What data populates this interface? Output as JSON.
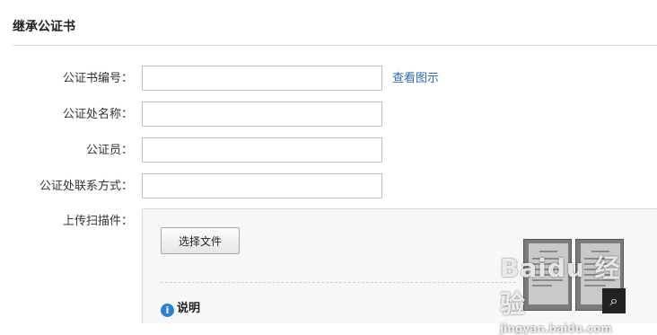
{
  "section": {
    "title": "继承公证书"
  },
  "form": {
    "fields": [
      {
        "label": "公证书编号：",
        "value": "",
        "placeholder": ""
      },
      {
        "label": "公证处名称：",
        "value": "",
        "placeholder": ""
      },
      {
        "label": "公证员：",
        "value": "",
        "placeholder": ""
      },
      {
        "label": "公证处联系方式：",
        "value": "",
        "placeholder": ""
      }
    ],
    "view_sample_link": "查看图示",
    "upload": {
      "label": "上传扫描件：",
      "choose_file_button": "选择文件",
      "note_label": "说明",
      "zoom_icon": "magnifier-icon"
    }
  },
  "watermark": {
    "brand": "Baidu 经验",
    "domain": "jingyan.baidu.com"
  },
  "colors": {
    "link": "#2a6db5",
    "info_icon": "#2f7fd3",
    "rule": "#dcdcdc"
  }
}
